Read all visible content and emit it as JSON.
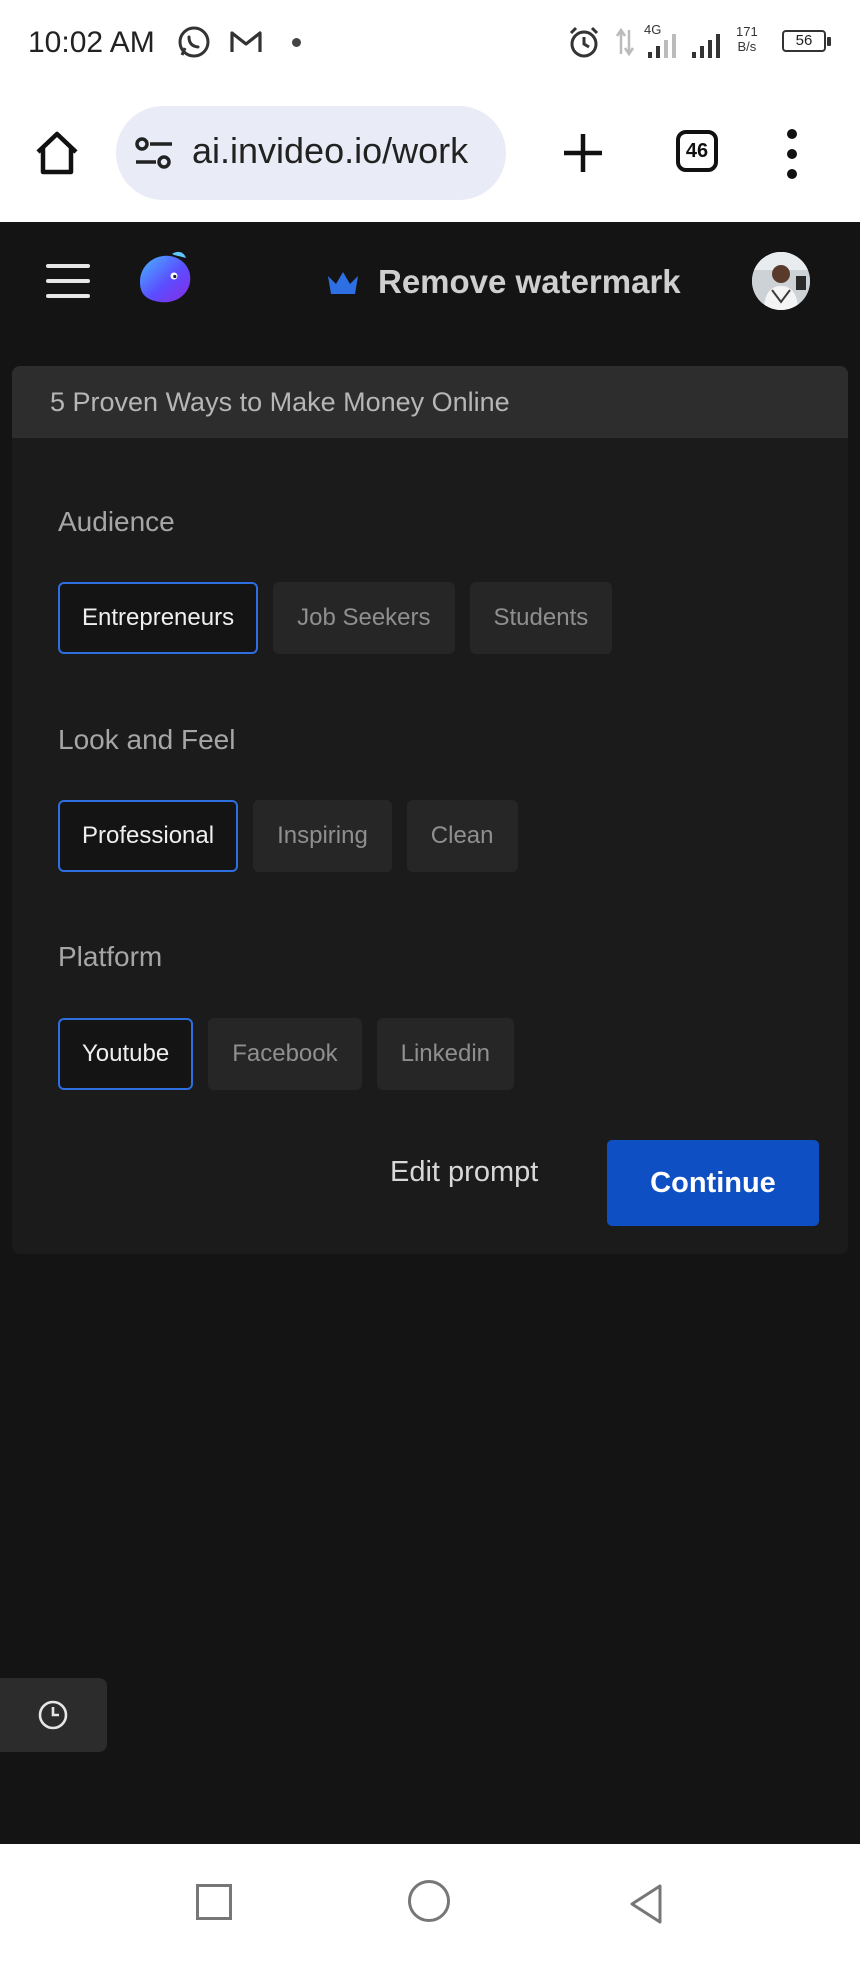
{
  "status_bar": {
    "time": "10:02 AM",
    "icons": [
      "whatsapp-icon",
      "gmail-icon",
      "notification-dot",
      "alarm-icon",
      "data-arrows-icon",
      "signal-4g-icon",
      "signal-icon"
    ],
    "network_label": "4G",
    "net_speed_value": "171",
    "net_speed_unit": "B/s",
    "battery": "56"
  },
  "browser": {
    "url": "ai.invideo.io/work",
    "tab_count": "46",
    "icons": [
      "home-icon",
      "site-settings-icon",
      "new-tab-icon",
      "tabs-icon",
      "more-options-icon"
    ]
  },
  "app_header": {
    "remove_watermark": "Remove watermark",
    "icons": [
      "menu-icon",
      "invideo-logo",
      "crown-icon",
      "avatar"
    ],
    "accent": "#2d6ee0"
  },
  "card": {
    "title": "5 Proven Ways to Make Money Online",
    "sections": [
      {
        "label": "Audience",
        "options": [
          "Entrepreneurs",
          "Job Seekers",
          "Students"
        ],
        "selected": "Entrepreneurs"
      },
      {
        "label": "Look and Feel",
        "options": [
          "Professional",
          "Inspiring",
          "Clean"
        ],
        "selected": "Professional"
      },
      {
        "label": "Platform",
        "options": [
          "Youtube",
          "Facebook",
          "Linkedin"
        ],
        "selected": "Youtube"
      }
    ],
    "edit_prompt": "Edit prompt",
    "continue": "Continue",
    "continue_color": "#0f4fc4"
  },
  "floating": {
    "icon": "history-clock-icon"
  },
  "nav_bar": {
    "icons": [
      "recents-square-icon",
      "home-circle-icon",
      "back-triangle-icon"
    ]
  }
}
